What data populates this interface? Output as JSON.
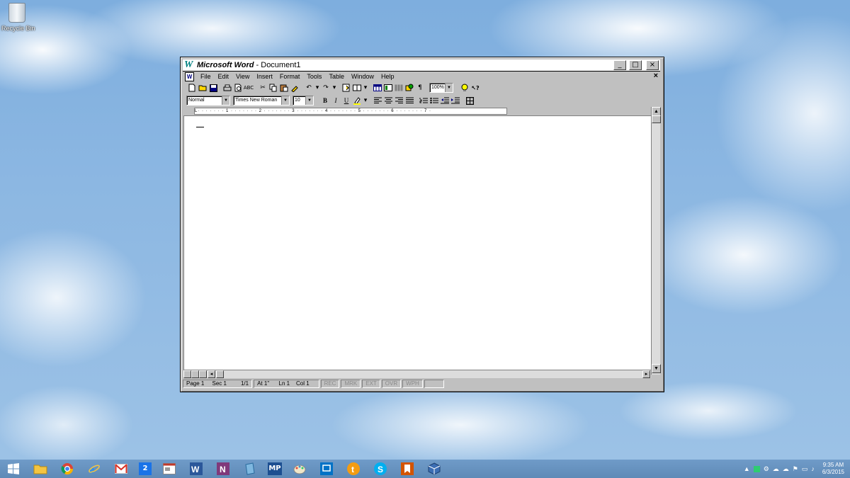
{
  "desktop": {
    "recycle_bin_label": "Recycle Bin"
  },
  "window": {
    "app_name": "Microsoft Word",
    "title_suffix": " - Document1",
    "controls": {
      "minimize": "_",
      "maximize": "□",
      "close": "×"
    }
  },
  "menu": {
    "items": [
      "File",
      "Edit",
      "View",
      "Insert",
      "Format",
      "Tools",
      "Table",
      "Window",
      "Help"
    ],
    "doc_close": "×"
  },
  "formatting": {
    "style": "Normal",
    "font": "Times New Roman",
    "size": "10",
    "zoom": "100%",
    "bold": "B",
    "italic": "I",
    "underline": "U",
    "pilcrow": "¶"
  },
  "ruler": {
    "ticks": "L· · · · · · · 1 · · · · · · · 2 · · · · · · · 3 · · · · · · · 4 · · · · · · · 5 · · · · · · · 6 · · · · · · · 7 ·"
  },
  "status": {
    "page": "Page 1",
    "sec": "Sec 1",
    "pages": "1/1",
    "at": "At 1\"",
    "ln": "Ln 1",
    "col": "Col 1",
    "rec": "REC",
    "mrk": "MRK",
    "ext": "EXT",
    "ovr": "OVR",
    "wph": "WPH"
  },
  "taskbar": {
    "calendar_day": "2",
    "mp_label": "MP",
    "time": "9:35 AM",
    "date": "6/3/2015"
  },
  "colors": {
    "word_logo": "#008080",
    "taskbar": "#6f9bc8"
  }
}
